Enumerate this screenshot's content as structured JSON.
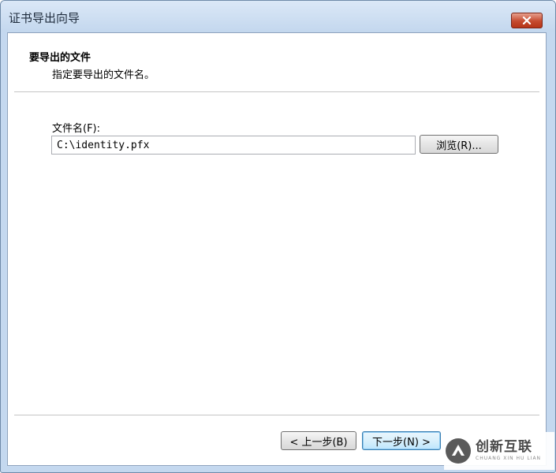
{
  "window": {
    "title": "证书导出向导"
  },
  "header": {
    "title": "要导出的文件",
    "subtitle": "指定要导出的文件名。"
  },
  "form": {
    "file_label": "文件名(F):",
    "file_value": "C:\\identity.pfx",
    "browse_label": "浏览(R)..."
  },
  "footer": {
    "back_label": "< 上一步(B)",
    "next_label": "下一步(N) >"
  },
  "watermark": {
    "text": "创新互联",
    "subtext": "CHUANG XIN HU LIAN"
  },
  "colors": {
    "title_bar": "#c3d7ee",
    "close_button": "#c54a2f",
    "default_button_border": "#3c7fb1"
  },
  "icons": {
    "close": "close-x-icon",
    "watermark_logo": "chuangxin-logo-icon"
  }
}
